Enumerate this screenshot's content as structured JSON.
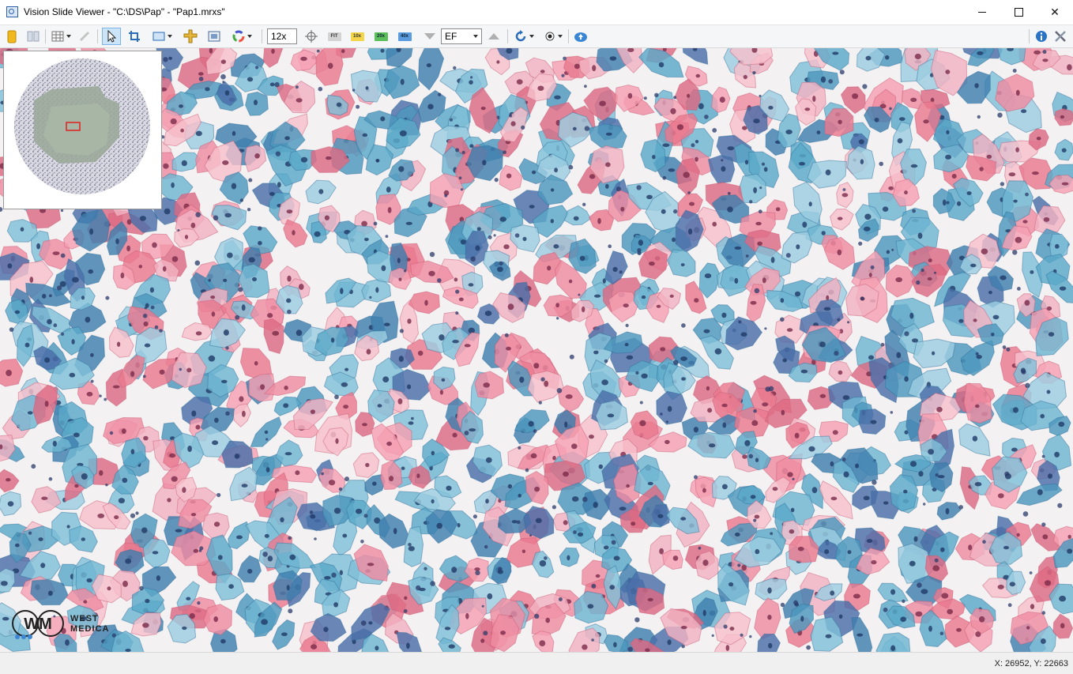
{
  "window": {
    "title": "Vision Slide Viewer - \"C:\\DS\\Pap\" - \"Pap1.mrxs\""
  },
  "toolbar": {
    "zoom_value": "12x",
    "fit_label": "FIT",
    "mag_10x": "10x",
    "mag_20x": "20x",
    "mag_40x": "40x",
    "focus_mode": "EF"
  },
  "logo": {
    "initials": "WM",
    "line1": "WEST",
    "line2": "MEDICA"
  },
  "status": {
    "coordinates": "X: 26952, Y: 22663"
  },
  "colors": {
    "eosinophilic_cell": "#f08ca0",
    "cyanophilic_cell": "#5aa8c8",
    "nucleus": "#2b3e6e",
    "background": "#f4f1f3",
    "selection_rect": "#e02020"
  }
}
